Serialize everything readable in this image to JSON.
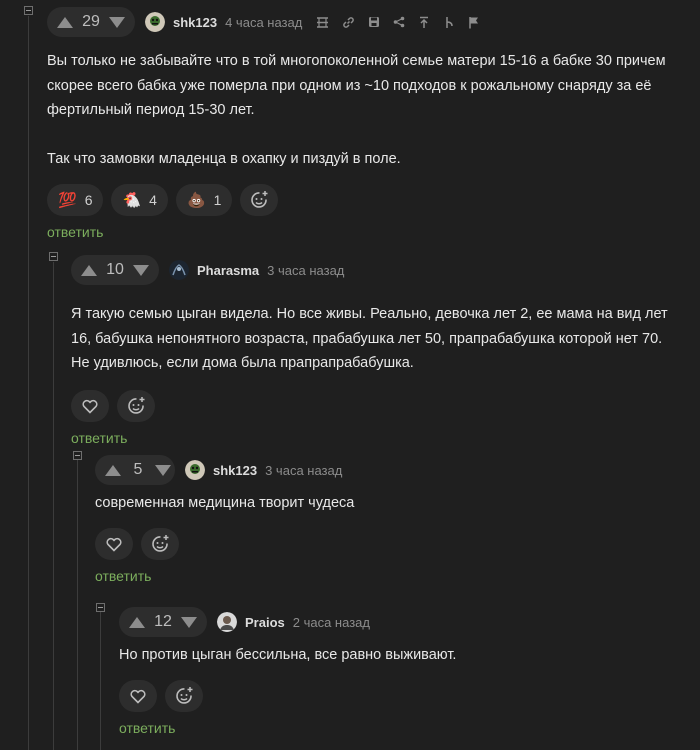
{
  "comments": [
    {
      "rating": "29",
      "author": "shk123",
      "time": "4 часа назад",
      "text": [
        "Вы только не забывайте что в той многопоколенной семье матери 15-16 а бабке 30 причем скорее всего бабка уже померла при одном из ~10 подходов к рожальному снаряду за её фертильный период 15-30 лет.",
        "Так что замовки младенца в охапку и пиздуй в поле."
      ],
      "reactions": [
        {
          "emoji": "💯",
          "count": "6"
        },
        {
          "emoji": "🐔",
          "count": "4"
        },
        {
          "emoji": "💩",
          "count": "1"
        }
      ],
      "reply": "ответить"
    },
    {
      "rating": "10",
      "author": "Pharasma",
      "time": "3 часа назад",
      "text": [
        "Я такую семью цыган видела. Но все живы. Реально, девочка лет 2, ее мама на вид лет 16, бабушка непонятного возраста, прабабушка лет 50, прапрабабушка которой нет 70. Не удивлюсь, если дома была прапрапрабабушка."
      ],
      "reply": "ответить"
    },
    {
      "rating": "5",
      "author": "shk123",
      "time": "3 часа назад",
      "text": [
        "современная медицина творит чудеса"
      ],
      "reply": "ответить"
    },
    {
      "rating": "12",
      "author": "Praios",
      "time": "2 часа назад",
      "text": [
        "Но против цыган бессильна, все равно выживают."
      ],
      "reply": "ответить"
    }
  ],
  "icons": {
    "toolbar": [
      "subscribe-icon",
      "link-icon",
      "save-icon",
      "share-icon",
      "go-to-parent-icon",
      "branch-icon",
      "report-icon"
    ],
    "like": "heart-icon",
    "add_reaction": "add-reaction-icon"
  },
  "colors": {
    "background": "#1f1f1f",
    "pill": "#2d2d2d",
    "reply_link": "#7cae5d",
    "muted": "#8c8c8c"
  }
}
